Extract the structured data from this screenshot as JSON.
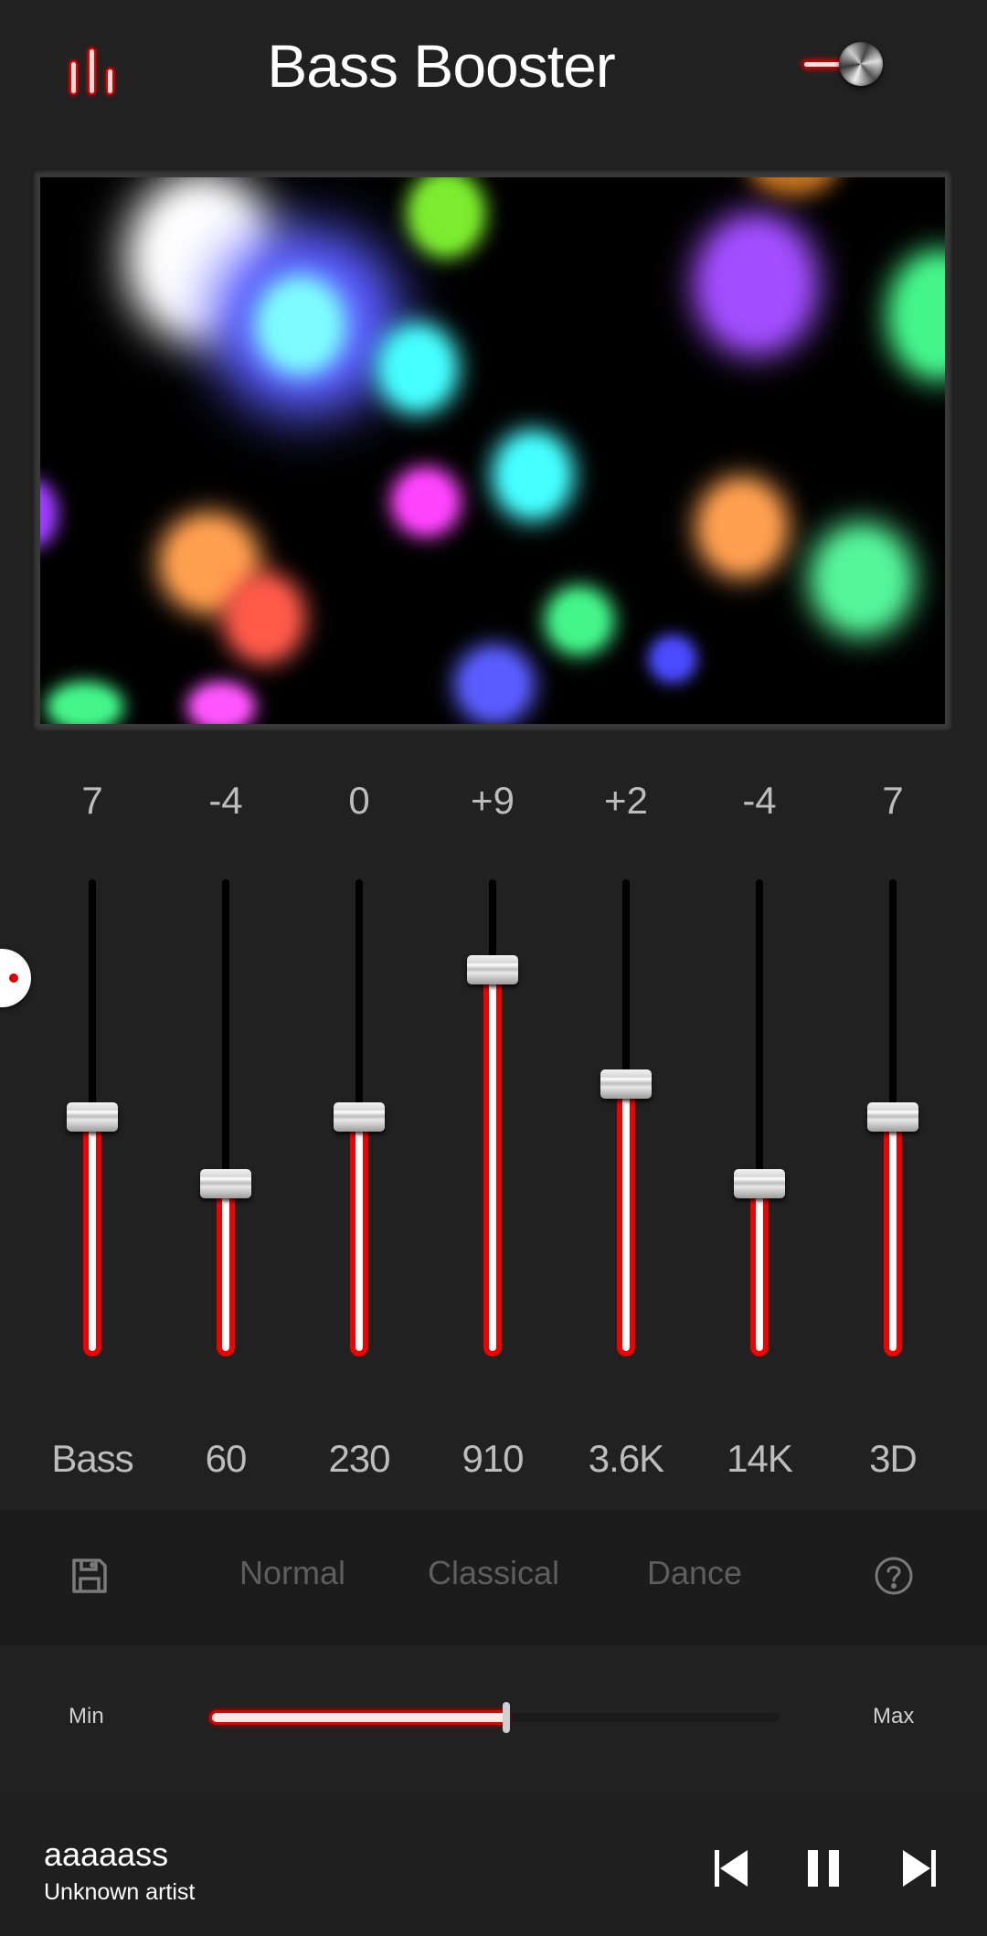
{
  "header": {
    "title": "Bass Booster",
    "left_icon": "equalizer-bars-icon",
    "power_toggle": {
      "icon": "power-knob-toggle",
      "state": "on"
    }
  },
  "visualizer": {
    "type": "colored-light-orbs",
    "orbs": [
      {
        "color": "#ffffff"
      },
      {
        "color": "#7cec2e"
      },
      {
        "color": "#5a5cff"
      },
      {
        "color": "#7dfbff"
      },
      {
        "color": "#a24dff"
      },
      {
        "color": "#44f58a"
      },
      {
        "color": "#46ffff"
      },
      {
        "color": "#46ffff"
      },
      {
        "color": "#ff44ff"
      },
      {
        "color": "#ffa050"
      },
      {
        "color": "#ff5a4a"
      },
      {
        "color": "#9d3dff"
      },
      {
        "color": "#ffa050"
      },
      {
        "color": "#55f59a"
      },
      {
        "color": "#44f58a"
      },
      {
        "color": "#4a4aff"
      },
      {
        "color": "#5a5cff"
      },
      {
        "color": "#ff55ff"
      },
      {
        "color": "#44f58a"
      },
      {
        "color": "#c07020"
      }
    ]
  },
  "equalizer": {
    "bands": [
      {
        "label": "Bass",
        "value_text": "7",
        "level": 0.5
      },
      {
        "label": "60",
        "value_text": "-4",
        "level": 0.36
      },
      {
        "label": "230",
        "value_text": "0",
        "level": 0.5
      },
      {
        "label": "910",
        "value_text": "+9",
        "level": 0.81
      },
      {
        "label": "3.6K",
        "value_text": "+2",
        "level": 0.57
      },
      {
        "label": "14K",
        "value_text": "-4",
        "level": 0.36
      },
      {
        "label": "3D",
        "value_text": "7",
        "level": 0.5
      }
    ],
    "side_handle_icon": "drawer-handle-icon"
  },
  "presets": {
    "save_icon": "floppy-disk-save-icon",
    "items": [
      "Normal",
      "Classical",
      "Dance"
    ],
    "help_icon": "question-circle-icon"
  },
  "volume": {
    "min_label": "Min",
    "max_label": "Max",
    "level": 0.52
  },
  "player": {
    "song_title": "aaaaass",
    "artist": "Unknown artist",
    "controls": [
      "previous-track",
      "pause",
      "next-track"
    ]
  },
  "colors": {
    "accent": "#e00000",
    "background": "#212121",
    "preset_text": "#5e5e5e",
    "band_text": "#bdbdbd"
  }
}
